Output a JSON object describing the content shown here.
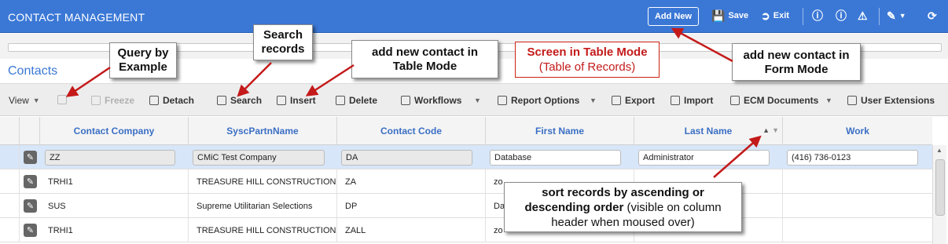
{
  "header": {
    "title": "CONTACT MANAGEMENT",
    "add_new": "Add New",
    "save": "Save",
    "exit": "Exit"
  },
  "section_title": "Contacts",
  "toolbar": {
    "view": "View",
    "freeze": "Freeze",
    "detach": "Detach",
    "search": "Search",
    "insert": "Insert",
    "delete": "Delete",
    "workflows": "Workflows",
    "report_options": "Report Options",
    "export": "Export",
    "import": "Import",
    "ecm_documents": "ECM Documents",
    "user_extensions": "User Extensions"
  },
  "table": {
    "columns": [
      "Contact Company",
      "SyscPartnName",
      "Contact Code",
      "First Name",
      "Last Name",
      "Work"
    ],
    "rows": [
      [
        "ZZ",
        "CMiC Test Company",
        "DA",
        "Database",
        "Administrator",
        "(416) 736-0123"
      ],
      [
        "TRHI1",
        "TREASURE HILL CONSTRUCTION",
        "ZA",
        "zo",
        "",
        ""
      ],
      [
        "SUS",
        "Supreme Utilitarian Selections",
        "DP",
        "Da",
        "",
        ""
      ],
      [
        "TRHI1",
        "TREASURE HILL CONSTRUCTION",
        "ZALL",
        "zo",
        "",
        ""
      ]
    ]
  },
  "annotations": {
    "qbe": [
      "Query by",
      "Example"
    ],
    "search": [
      "Search",
      "records"
    ],
    "insert": [
      "add new contact in",
      "Table Mode"
    ],
    "table_mode": [
      "Screen in Table Mode",
      "(Table of Records)"
    ],
    "form_mode": [
      "add new contact in",
      "Form Mode"
    ],
    "sort_bold": "sort records by ascending or descending order",
    "sort_normal": "(visible on column header when moused over)"
  }
}
